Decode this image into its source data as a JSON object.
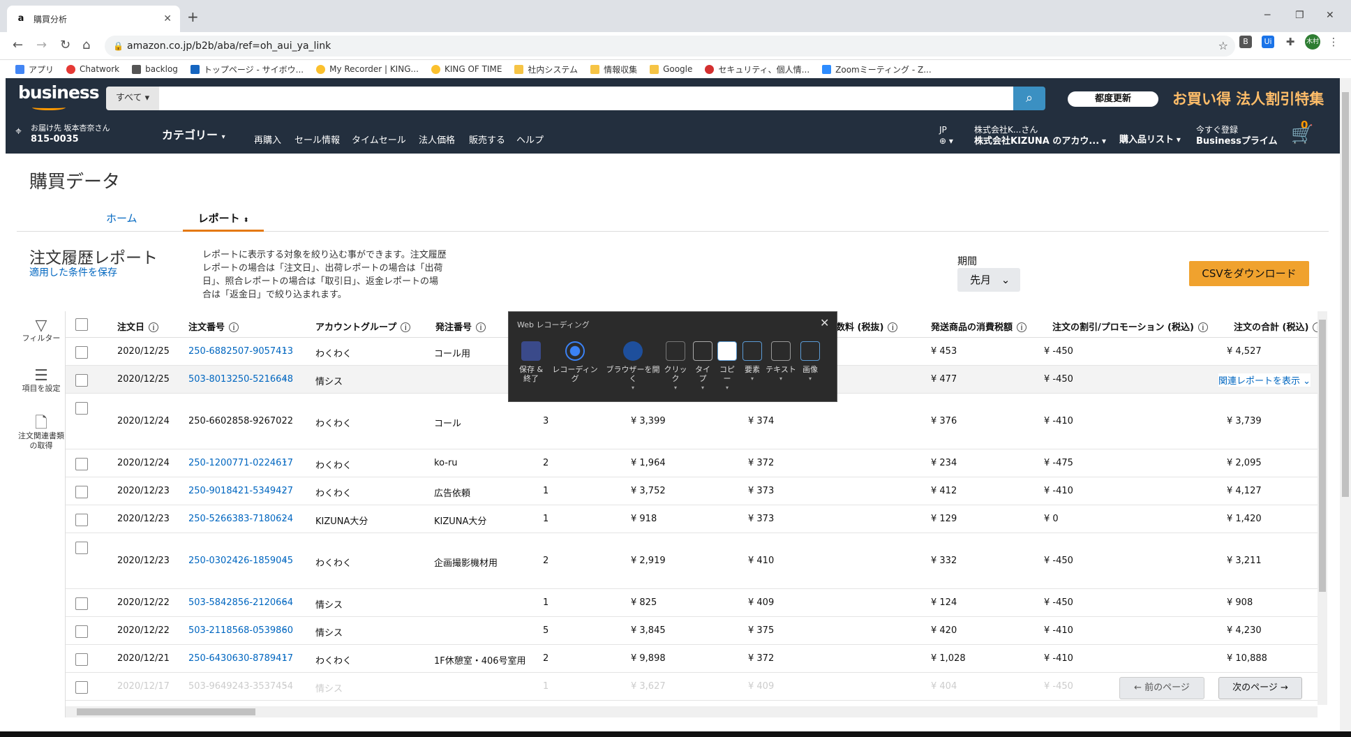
{
  "browser": {
    "tab_title": "購買分析",
    "tab_favicon": "a",
    "url": "amazon.co.jp/b2b/aba/ref=oh_aui_ya_link",
    "profile_label": "木村",
    "bookmarks": [
      "アプリ",
      "Chatwork",
      "backlog",
      "トップページ - サイボウ...",
      "My Recorder | KING...",
      "KING OF TIME",
      "社内システム",
      "情報収集",
      "Google",
      "セキュリティ、個人情...",
      "Zoomミーティング - Z..."
    ]
  },
  "amazon": {
    "logo": "business",
    "search_dept": "すべて",
    "refresh_label": "都度更新",
    "promo": "お買い得 法人割引特集",
    "deliver_line1": "お届け先 坂本杏奈さん",
    "deliver_line2": "815-0035",
    "category_label": "カテゴリー",
    "nav_links": [
      "再購入",
      "セール情報",
      "タイムセール",
      "法人価格",
      "販売する",
      "ヘルプ"
    ],
    "lang": "JP",
    "account_line1": "株式会社K...さん",
    "account_line2": "株式会社KIZUNA のアカウ...",
    "purchase_list": "購入品リスト",
    "prime_line1": "今すぐ登録",
    "prime_line2": "Businessプライム",
    "cart_count": "0"
  },
  "page": {
    "title": "購買データ",
    "tab_home": "ホーム",
    "tab_report": "レポート",
    "report_title": "注文履歴レポート",
    "save_conditions": "適用した条件を保存",
    "description": "レポートに表示する対象を絞り込む事ができます。注文履歴レポートの場合は「注文日」、出荷レポートの場合は「出荷日」、照合レポートの場合は「取引日」、返金レポートの場合は「返金日」で絞り込まれます。",
    "period_label": "期間",
    "period_value": "先月",
    "csv_button": "CSVをダウンロード",
    "sidebar": {
      "filter": "フィルター",
      "columns": "項目を設定",
      "docs": "注文関連書類の取得"
    },
    "related_link": "関連レポートを表示",
    "prev_page": "← 前のページ",
    "next_page": "次のページ →"
  },
  "table": {
    "headers": [
      "注文日",
      "注文番号",
      "アカウントグループ",
      "発注番号",
      "数料 (税抜)",
      "発送商品の消費税額",
      "注文の割引/プロモーション (税込)",
      "注文の合計 (税込)"
    ],
    "rows": [
      {
        "date": "2020/12/25",
        "order": "250-6882507-9057413",
        "group": "わくわく",
        "po": "コール用",
        "qty": "",
        "sub": "",
        "fee": "",
        "tax": "¥ 453",
        "disc": "¥ -450",
        "total": "¥ 4,527",
        "link": true
      },
      {
        "date": "2020/12/25",
        "order": "503-8013250-5216648",
        "group": "情シス",
        "po": "",
        "qty": "",
        "sub": "",
        "fee": "",
        "tax": "¥ 477",
        "disc": "¥ -450",
        "total": "",
        "link": true
      },
      {
        "date": "2020/12/24",
        "order": "250-6602858-9267022",
        "group": "わくわく",
        "po": "コール",
        "qty": "3",
        "sub": "¥ 3,399",
        "fee": "¥ 374",
        "tax": "¥ 376",
        "disc": "¥ -410",
        "total": "¥ 3,739",
        "link": false
      },
      {
        "date": "2020/12/24",
        "order": "250-1200771-0224617",
        "group": "わくわく",
        "po": "ko-ru",
        "qty": "2",
        "sub": "¥ 1,964",
        "fee": "¥ 372",
        "tax": "¥ 234",
        "disc": "¥ -475",
        "total": "¥ 2,095",
        "link": true
      },
      {
        "date": "2020/12/23",
        "order": "250-9018421-5349427",
        "group": "わくわく",
        "po": "広告依頼",
        "qty": "1",
        "sub": "¥ 3,752",
        "fee": "¥ 373",
        "tax": "¥ 412",
        "disc": "¥ -410",
        "total": "¥ 4,127",
        "link": true
      },
      {
        "date": "2020/12/23",
        "order": "250-5266383-7180624",
        "group": "KIZUNA大分",
        "po": "KIZUNA大分",
        "qty": "1",
        "sub": "¥ 918",
        "fee": "¥ 373",
        "tax": "¥ 129",
        "disc": "¥ 0",
        "total": "¥ 1,420",
        "link": true
      },
      {
        "date": "2020/12/23",
        "order": "250-0302426-1859045",
        "group": "わくわく",
        "po": "企画撮影機材用",
        "qty": "2",
        "sub": "¥ 2,919",
        "fee": "¥ 410",
        "tax": "¥ 332",
        "disc": "¥ -450",
        "total": "¥ 3,211",
        "link": true
      },
      {
        "date": "2020/12/22",
        "order": "503-5842856-2120664",
        "group": "情シス",
        "po": "",
        "qty": "1",
        "sub": "¥ 825",
        "fee": "¥ 409",
        "tax": "¥ 124",
        "disc": "¥ -450",
        "total": "¥ 908",
        "link": true
      },
      {
        "date": "2020/12/22",
        "order": "503-2118568-0539860",
        "group": "情シス",
        "po": "",
        "qty": "5",
        "sub": "¥ 3,845",
        "fee": "¥ 375",
        "tax": "¥ 420",
        "disc": "¥ -410",
        "total": "¥ 4,230",
        "link": true
      },
      {
        "date": "2020/12/21",
        "order": "250-6430630-8789417",
        "group": "わくわく",
        "po": "1F休憩室・406号室用",
        "qty": "2",
        "sub": "¥ 9,898",
        "fee": "¥ 372",
        "tax": "¥ 1,028",
        "disc": "¥ -410",
        "total": "¥ 10,888",
        "link": true
      },
      {
        "date": "2020/12/17",
        "order": "503-9649243-3537454",
        "group": "情シス",
        "po": "",
        "qty": "1",
        "sub": "¥ 3,627",
        "fee": "¥ 409",
        "tax": "¥ 404",
        "disc": "¥ -450",
        "total": "",
        "link": true
      }
    ]
  },
  "recorder": {
    "title": "Web レコーディング",
    "tools": [
      "保存 & 終了",
      "レコーディング",
      "ブラウザーを開く",
      "クリック",
      "タイプ",
      "コピー",
      "要素",
      "テキスト",
      "画像"
    ]
  },
  "colors": {
    "amazon_dark": "#232f3e",
    "amazon_orange": "#f90",
    "link": "#0066c0",
    "csv": "#f0a22e"
  }
}
